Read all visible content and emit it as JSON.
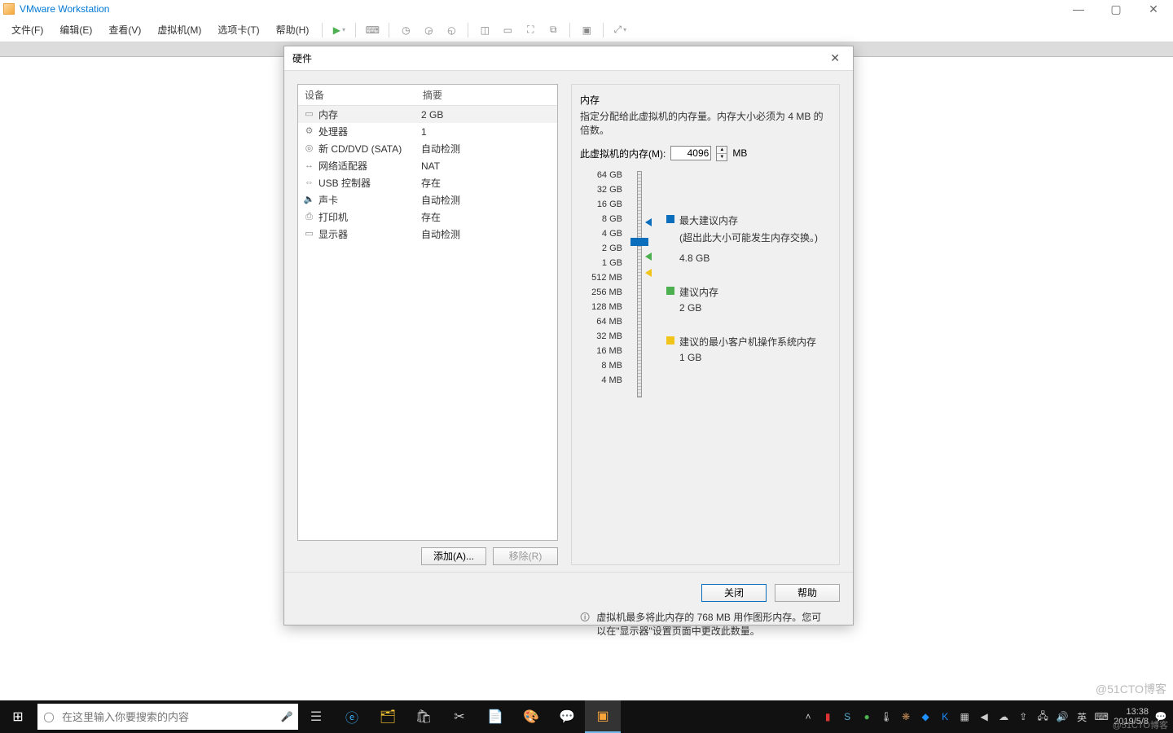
{
  "app": {
    "title": "VMware Workstation"
  },
  "win_controls": {
    "min": "—",
    "max": "▢",
    "close": "✕"
  },
  "menu": [
    "文件(F)",
    "编辑(E)",
    "查看(V)",
    "虚拟机(M)",
    "选项卡(T)",
    "帮助(H)"
  ],
  "dialog": {
    "title": "硬件",
    "device_header": {
      "c1": "设备",
      "c2": "摘要"
    },
    "devices": [
      {
        "icon": "▭",
        "name": "内存",
        "summary": "2 GB",
        "sel": true
      },
      {
        "icon": "⚙",
        "name": "处理器",
        "summary": "1"
      },
      {
        "icon": "◎",
        "name": "新 CD/DVD (SATA)",
        "summary": "自动检测"
      },
      {
        "icon": "↔",
        "name": "网络适配器",
        "summary": "NAT"
      },
      {
        "icon": "⇔",
        "name": "USB 控制器",
        "summary": "存在"
      },
      {
        "icon": "🔈",
        "name": "声卡",
        "summary": "自动检测"
      },
      {
        "icon": "⎙",
        "name": "打印机",
        "summary": "存在"
      },
      {
        "icon": "▭",
        "name": "显示器",
        "summary": "自动检测"
      }
    ],
    "add_btn": "添加(A)...",
    "remove_btn": "移除(R)",
    "close_btn": "关闭",
    "help_btn": "帮助"
  },
  "memory": {
    "heading": "内存",
    "desc": "指定分配给此虚拟机的内存量。内存大小必须为 4 MB 的倍数。",
    "label": "此虚拟机的内存(M):",
    "value": "4096",
    "unit": "MB",
    "ticks": [
      "64 GB",
      "32 GB",
      "16 GB",
      "8 GB",
      "4 GB",
      "2 GB",
      "1 GB",
      "512 MB",
      "256 MB",
      "128 MB",
      "64 MB",
      "32 MB",
      "16 MB",
      "8 MB",
      "4 MB"
    ],
    "legend": {
      "max_label": "最大建议内存",
      "max_note": "(超出此大小可能发生内存交换。)",
      "max_val": "4.8 GB",
      "rec_label": "建议内存",
      "rec_val": "2 GB",
      "min_label": "建议的最小客户机操作系统内存",
      "min_val": "1 GB"
    },
    "note": "虚拟机最多将此内存的 768 MB 用作图形内存。您可以在\"显示器\"设置页面中更改此数量。"
  },
  "taskbar": {
    "search_placeholder": "在这里输入你要搜索的内容",
    "clock_time": "13:38",
    "clock_date": "2019/5/8",
    "ime": "英"
  },
  "watermark": "@51CTO博客"
}
